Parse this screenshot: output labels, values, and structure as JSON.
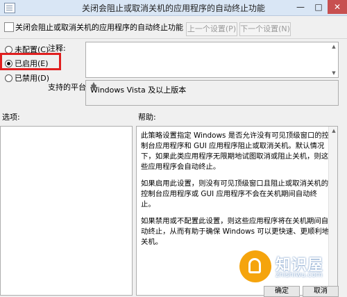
{
  "window": {
    "title": "关闭会阻止或取消关机的应用程序的自动终止功能",
    "minimize_glyph": "—",
    "maximize_glyph": "□",
    "close_glyph": "✕"
  },
  "header": {
    "policy_name": "关闭会阻止或取消关机的应用程序的自动终止功能",
    "prev_label": "上一个设置(P)",
    "next_label": "下一个设置(N)"
  },
  "state_options": [
    {
      "label": "未配置(C)",
      "checked": false
    },
    {
      "label": "已启用(E)",
      "checked": true
    },
    {
      "label": "已禁用(D)",
      "checked": false
    }
  ],
  "comment": {
    "label": "注释:",
    "value": ""
  },
  "platform": {
    "label": "支持的平台:",
    "value": "Windows Vista 及以上版本"
  },
  "sections": {
    "options_label": "选项:",
    "help_label": "帮助:"
  },
  "help": {
    "paragraphs": [
      "此策略设置指定 Windows 是否允许没有可见顶级窗口的控制台应用程序和 GUI 应用程序阻止或取消关机。默认情况下，如果此类应用程序无限期地试图取消或阻止关机，则这些应用程序会自动终止。",
      "如果启用此设置，则没有可见顶级窗口且阻止或取消关机的控制台应用程序或 GUI 应用程序不会在关机期间自动终止。",
      "如果禁用或不配置此设置，则这些应用程序将在关机期间自动终止，从而有助于确保 Windows 可以更快速、更顺利地关机。"
    ]
  },
  "footer": {
    "ok_label": "确定",
    "cancel_label": "取消"
  },
  "watermark": {
    "text": "知识屋",
    "url": "zhishiwu.com"
  },
  "colors": {
    "highlight": "#e01f1f",
    "close_button": "#c75050",
    "watermark": "#f5a40d"
  }
}
